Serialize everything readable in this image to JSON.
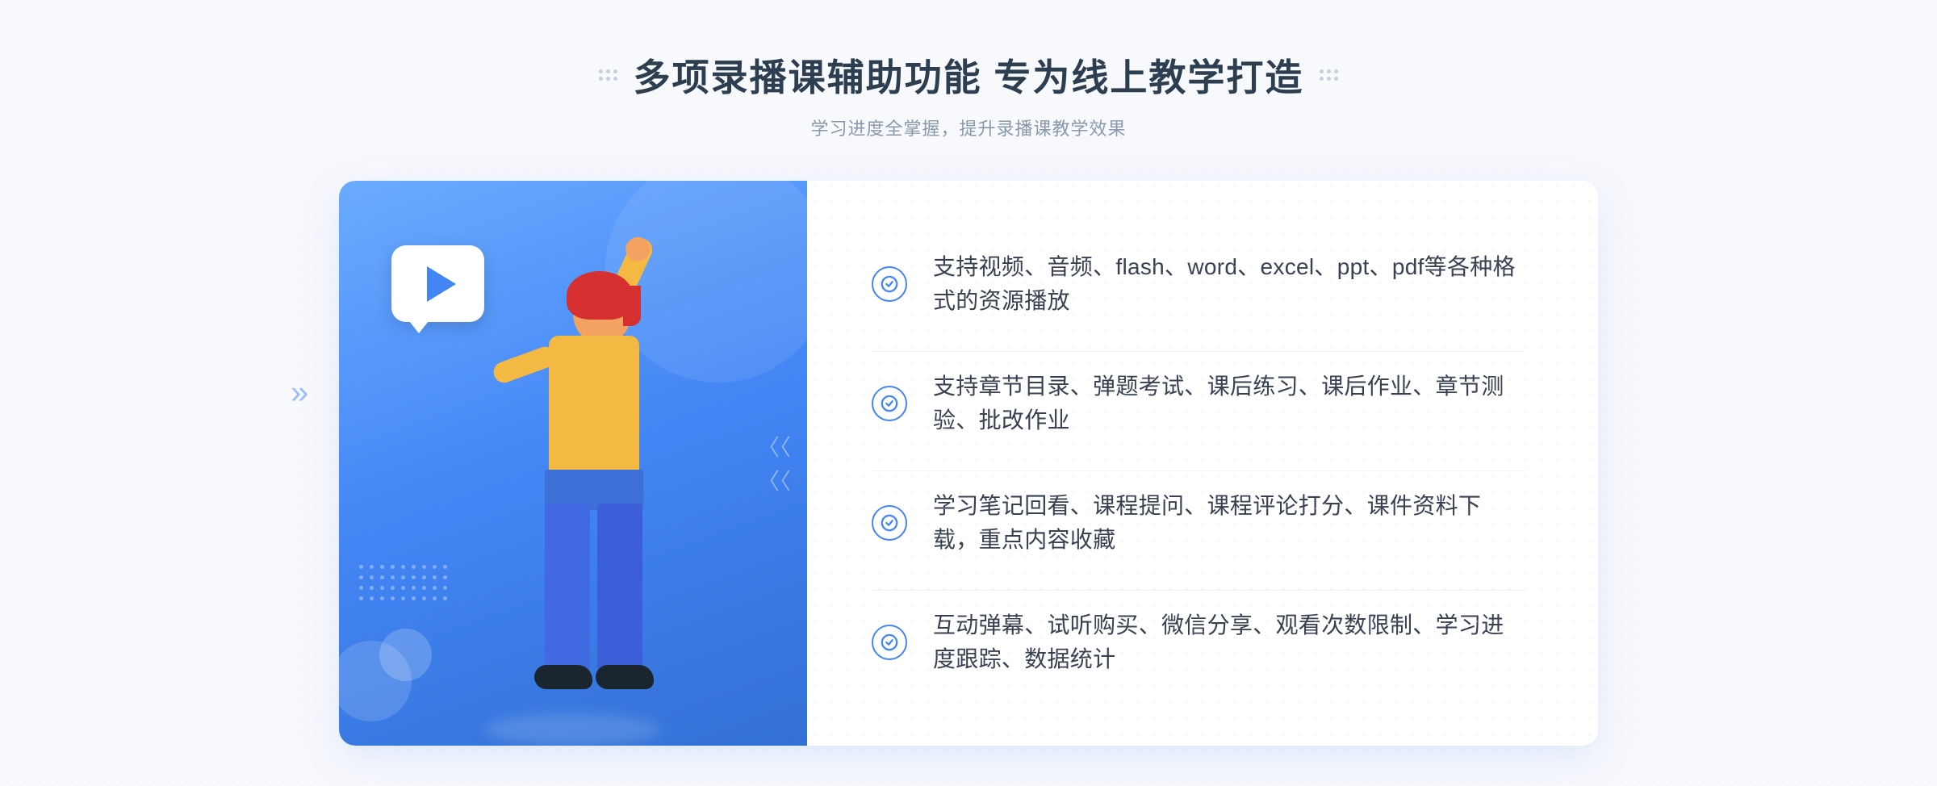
{
  "header": {
    "title": "多项录播课辅助功能 专为线上教学打造",
    "subtitle": "学习进度全掌握，提升录播课教学效果",
    "dots_label": "decorative-dots"
  },
  "features": [
    {
      "id": 1,
      "text": "支持视频、音频、flash、word、excel、ppt、pdf等各种格式的资源播放"
    },
    {
      "id": 2,
      "text": "支持章节目录、弹题考试、课后练习、课后作业、章节测验、批改作业"
    },
    {
      "id": 3,
      "text": "学习笔记回看、课程提问、课程评论打分、课件资料下载，重点内容收藏"
    },
    {
      "id": 4,
      "text": "互动弹幕、试听购买、微信分享、观看次数限制、学习进度跟踪、数据统计"
    }
  ],
  "illustration": {
    "play_button_label": "play",
    "person_label": "person-pointing-up"
  },
  "colors": {
    "primary_blue": "#4285f4",
    "light_blue": "#6aabff",
    "dark_blue": "#3270d4",
    "text_dark": "#374151",
    "text_light": "#8899aa",
    "border": "#f0f3f8"
  }
}
